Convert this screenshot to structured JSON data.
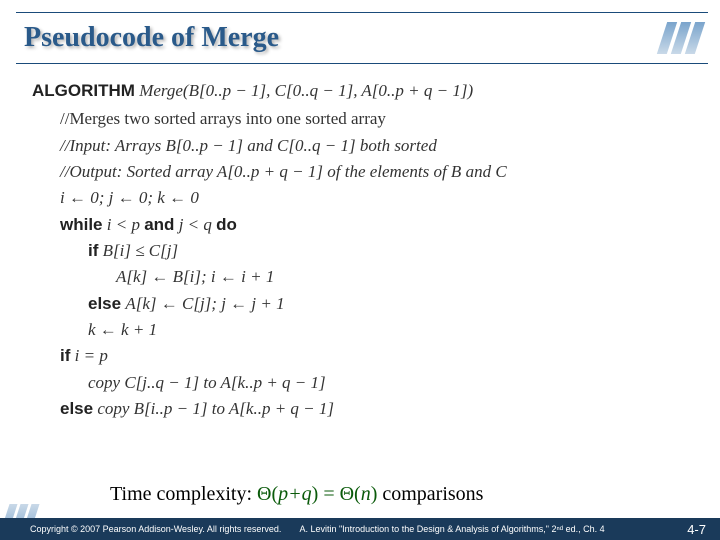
{
  "title": "Pseudocode of Merge",
  "algorithm": {
    "keyword": "ALGORITHM",
    "signature": "Merge(B[0..p − 1], C[0..q − 1], A[0..p + q − 1])",
    "comment1": "//Merges two sorted arrays into one sorted array",
    "comment2": "//Input: Arrays B[0..p − 1] and C[0..q − 1] both sorted",
    "comment3": "//Output: Sorted array A[0..p + q − 1] of the elements of B and C",
    "init": "i ← 0;  j ← 0;  k ← 0",
    "while_kw": "while",
    "while_cond1": "i < p",
    "and_kw": "and",
    "while_cond2": "j < q",
    "do_kw": "do",
    "if_kw": "if",
    "if_cond": "B[i] ≤ C[j]",
    "then_body": "A[k] ← B[i];  i ← i + 1",
    "else_kw": "else",
    "else_body": "A[k] ← C[j];  j ← j + 1",
    "k_inc": "k ← k + 1",
    "if2_kw": "if",
    "if2_cond": "i = p",
    "copy1": "copy C[j..q − 1] to A[k..p + q − 1]",
    "else2_kw": "else",
    "copy2": "copy B[i..p − 1] to A[k..p + q − 1]"
  },
  "complexity": {
    "label": "Time complexity: ",
    "expr": "Θ(p+q) = Θ(n)",
    "suffix": " comparisons"
  },
  "footer": {
    "copyright": "Copyright © 2007 Pearson Addison-Wesley. All rights reserved.",
    "reference": "A. Levitin \"Introduction to the Design & Analysis of Algorithms,\" 2ⁿᵈ ed., Ch. 4",
    "page": "4-7"
  }
}
